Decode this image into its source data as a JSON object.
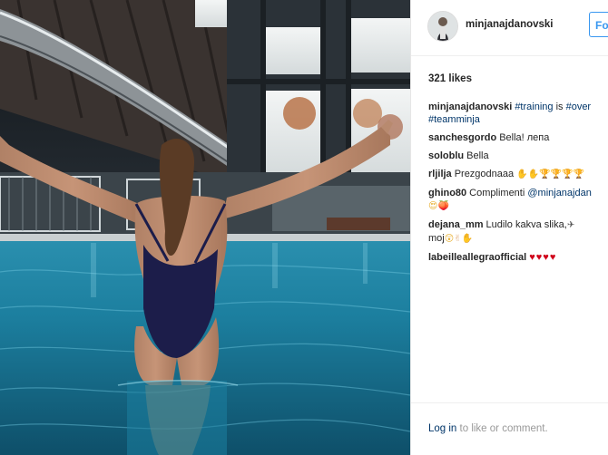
{
  "post": {
    "username": "minjanajdanovski",
    "follow_label": "Fo",
    "likes": "321 likes"
  },
  "comments": [
    {
      "user": "minjanajdanovski",
      "parts": [
        {
          "text": "#training",
          "tag": true
        },
        {
          "text": " is ",
          "tag": false
        },
        {
          "text": "#over",
          "tag": true
        }
      ],
      "line2": [
        {
          "text": "#teamminja",
          "tag": true
        }
      ]
    },
    {
      "user": "sanchesgordo",
      "parts": [
        {
          "text": "Bella! лепа",
          "tag": false
        }
      ]
    },
    {
      "user": "soloblu",
      "parts": [
        {
          "text": "Bella",
          "tag": false
        }
      ]
    },
    {
      "user": "rljilja",
      "parts": [
        {
          "text": "Prezgodnaaa ",
          "tag": false
        }
      ],
      "emojis": [
        {
          "glyph": "✋",
          "kind": "hand"
        },
        {
          "glyph": "✋",
          "kind": "hand"
        },
        {
          "glyph": "🏆",
          "kind": "trophy"
        },
        {
          "glyph": "🏆",
          "kind": "trophy"
        },
        {
          "glyph": "🏆",
          "kind": "trophy"
        },
        {
          "glyph": "🏆",
          "kind": "trophy"
        }
      ]
    },
    {
      "user": "ghino80",
      "parts": [
        {
          "text": "Complimenti ",
          "tag": false
        },
        {
          "text": "@minjanajdan",
          "tag": true
        }
      ],
      "line2_emojis": [
        {
          "glyph": "😍",
          "kind": "face"
        },
        {
          "glyph": "🍑",
          "kind": "peach"
        }
      ]
    },
    {
      "user": "dejana_mm",
      "parts": [
        {
          "text": "Ludilo kakva slika,",
          "tag": false
        }
      ],
      "emojis": [
        {
          "glyph": "✈",
          "kind": "plane"
        }
      ],
      "line2": [
        {
          "text": "moj",
          "tag": false
        }
      ],
      "line2_emojis": [
        {
          "glyph": "😲",
          "kind": "face"
        },
        {
          "glyph": "✌",
          "kind": "hand"
        },
        {
          "glyph": "✋",
          "kind": "hand"
        }
      ]
    },
    {
      "user": "labeilleallegraofficial",
      "parts": [],
      "hearts": "♥♥♥♥"
    }
  ],
  "footer": {
    "login_link": "Log in",
    "login_rest": " to like or comment."
  },
  "colors": {
    "link": "#003569",
    "follow_blue": "#3897f0",
    "heart_red": "#d0021b",
    "pool_water": "#1f8fae"
  },
  "icons": {
    "avatar": "profile-photo-avatar"
  }
}
